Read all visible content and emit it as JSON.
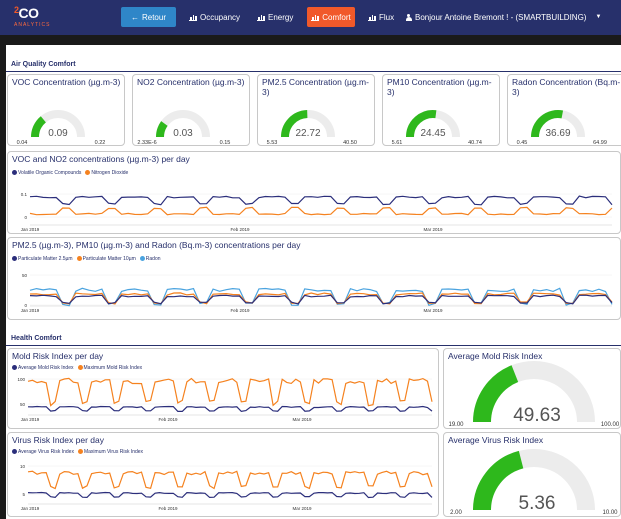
{
  "app": {
    "logo_text": "CO",
    "logo_star": "2",
    "logo_sub": "ANALYTICS"
  },
  "nav": {
    "back_label": "Retour",
    "items": [
      "Occupancy",
      "Energy",
      "Comfort",
      "Flux"
    ],
    "user_label": "Bonjour Antoine Bremont ! - (SMARTBUILDING)",
    "active": "Comfort"
  },
  "colors": {
    "navbar": "#27306b",
    "back": "#2f86c8",
    "active": "#f1592a",
    "gauge": "#2eb81c",
    "series_dark": "#2b2e7b",
    "series_orange": "#f5821f",
    "series_light": "#4aa3df"
  },
  "air_quality": {
    "title": "Air Quality Comfort",
    "gauges": [
      {
        "title": "VOC Concentration (µg.m-3)",
        "value": "0.09",
        "min": "0.04",
        "max": "0.22",
        "fraction": 0.28
      },
      {
        "title": "NO2 Concentration (µg.m-3)",
        "value": "0.03",
        "min": "2.33E-6",
        "max": "0.15",
        "fraction": 0.2
      },
      {
        "title": "PM2.5 Concentration (µg.m-3)",
        "value": "22.72",
        "min": "5.53",
        "max": "40.50",
        "fraction": 0.49
      },
      {
        "title": "PM10 Concentration (µg.m-3)",
        "value": "24.45",
        "min": "5.61",
        "max": "40.74",
        "fraction": 0.54
      },
      {
        "title": "Radon Concentration (Bq.m-3)",
        "value": "36.69",
        "min": "0.45",
        "max": "64.99",
        "fraction": 0.56
      }
    ]
  },
  "charts": {
    "voc_no2": {
      "title": "VOC and NO2 concentrations (µg.m-3) per day",
      "legend": [
        "Volatile Organic Compounds",
        "Nitrogen Dioxide"
      ],
      "yticks": [
        "0.1",
        "0"
      ],
      "xticks": [
        "Jan 2019",
        "Feb 2019",
        "Mar 2019"
      ]
    },
    "pm_radon": {
      "title": "PM2.5 (µg.m-3), PM10 (µg.m-3) and Radon (Bq.m-3) concentrations per day",
      "legend": [
        "Particulate Matter 2.5µm",
        "Particulate Matter 10µm",
        "Radon"
      ],
      "yticks": [
        "50",
        "0"
      ],
      "xticks": [
        "Jan 2019",
        "Feb 2019",
        "Mar 2019"
      ]
    },
    "mold": {
      "title": "Mold Risk Index per day",
      "legend": [
        "Average Mold Risk Index",
        "Maximum Mold Risk Index"
      ],
      "yticks": [
        "100",
        "50"
      ],
      "xticks": [
        "Jan 2019",
        "Feb 2019",
        "Mar 2019"
      ]
    },
    "virus": {
      "title": "Virus Risk Index per day",
      "legend": [
        "Average Virus Risk Index",
        "Maximum Virus Risk Index"
      ],
      "yticks": [
        "10",
        "5"
      ],
      "xticks": [
        "Jan 2019",
        "Feb 2019",
        "Mar 2019"
      ]
    }
  },
  "health": {
    "title": "Health Comfort",
    "avg_mold": {
      "title": "Average Mold Risk Index",
      "value": "49.63",
      "min": "19.00",
      "max": "100.00",
      "fraction": 0.38
    },
    "avg_virus": {
      "title": "Average Virus Risk Index",
      "value": "5.36",
      "min": "2.00",
      "max": "10.00",
      "fraction": 0.42
    }
  }
}
